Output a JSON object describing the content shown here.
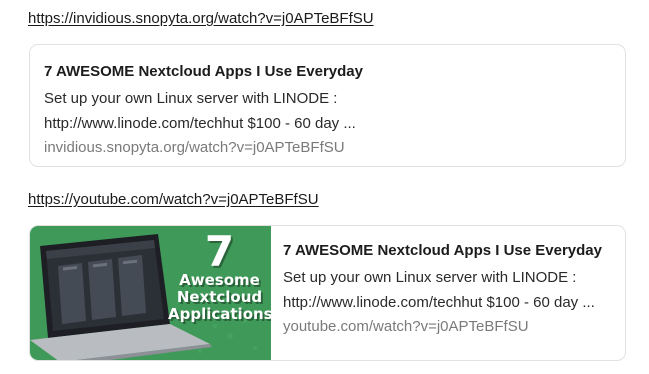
{
  "links": [
    {
      "url": "https://invidious.snopyta.org/watch?v=j0APTeBFfSU",
      "preview": {
        "title": "7 AWESOME Nextcloud Apps I Use Everyday",
        "description_line1": "Set up your own Linux server with LINODE :",
        "description_line2": "http://www.linode.com/techhut $100 - 60 day ...",
        "domain": "invidious.snopyta.org/watch?v=j0APTeBFfSU"
      }
    },
    {
      "url": "https://youtube.com/watch?v=j0APTeBFfSU",
      "preview": {
        "title": "7 AWESOME Nextcloud Apps I Use Everyday",
        "description_line1": "Set up your own Linux server with LINODE :",
        "description_line2": "http://www.linode.com/techhut $100 - 60 day ...",
        "domain": "youtube.com/watch?v=j0APTeBFfSU",
        "thumbnail": {
          "number": "7",
          "line1": "Awesome",
          "line2": "Nextcloud",
          "line3": "Applications",
          "background_color": "#3f9a59"
        }
      }
    }
  ]
}
